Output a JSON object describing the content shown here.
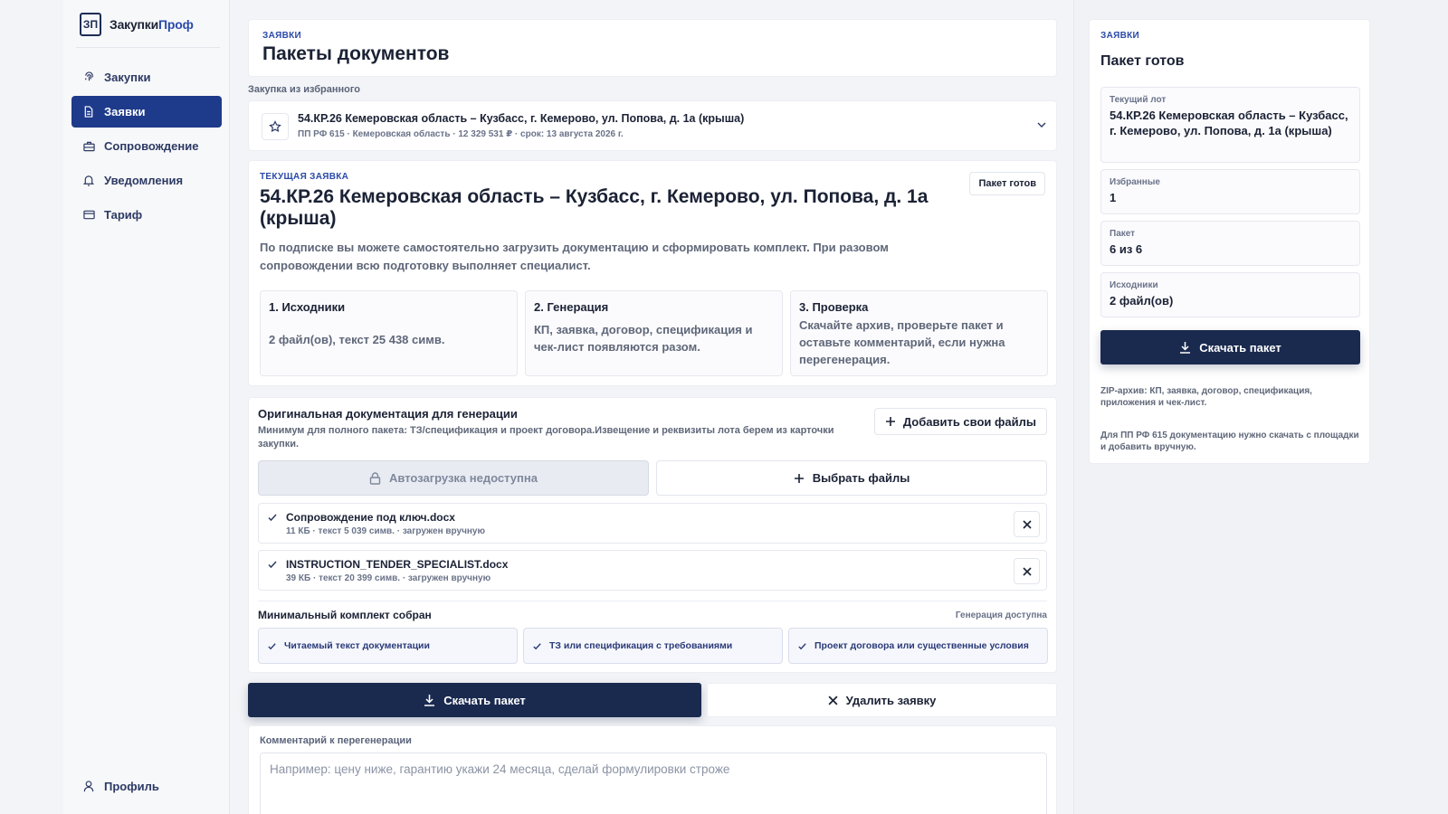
{
  "brand": {
    "name_part1": "Закупки",
    "name_part2": "Проф",
    "mark": "ЗП"
  },
  "sidebar": {
    "items": [
      {
        "label": "Закупки",
        "icon": "fingerprint-icon"
      },
      {
        "label": "Заявки",
        "icon": "document-icon",
        "active": true
      },
      {
        "label": "Сопровождение",
        "icon": "briefcase-icon"
      },
      {
        "label": "Уведомления",
        "icon": "bell-icon"
      },
      {
        "label": "Тариф",
        "icon": "card-icon"
      }
    ],
    "profile": "Профиль"
  },
  "header": {
    "eyebrow": "ЗАЯВКИ",
    "title": "Пакеты документов"
  },
  "lot_select": {
    "label": "Закупка из избранного",
    "title": "54.КР.26 Кемеровская область – Кузбасс, г. Кемерово, ул. Попова, д. 1а (крыша)",
    "subtitle": "ПП РФ 615 · Кемеровская область · 12 329 531 ₽ · срок: 13 августа 2026 г."
  },
  "current": {
    "eyebrow": "ТЕКУЩАЯ ЗАЯВКА",
    "badge": "Пакет готов",
    "title": "54.КР.26 Кемеровская область – Кузбасс, г. Кемерово, ул. Попова, д. 1а (крыша)",
    "description": "По подписке вы можете самостоятельно загрузить документацию и сформировать комплект. При разовом сопровождении всю подготовку выполняет специалист.",
    "steps": [
      {
        "title": "1. Исходники",
        "text": "2 файл(ов), текст 25 438 симв."
      },
      {
        "title": "2. Генерация",
        "text": "КП, заявка, договор, спецификация и чек-лист появляются разом."
      },
      {
        "title": "3. Проверка",
        "text": "Скачайте архив, проверьте пакет и оставьте комментарий, если нужна перегенерация."
      }
    ]
  },
  "originals": {
    "title": "Оригинальная документация для генерации",
    "description": "Минимум для полного пакета: ТЗ/спецификация и проект договора.Извещение и реквизиты лота берем из карточки закупки.",
    "add_button": "Добавить свои файлы",
    "auto_button": "Автозагрузка недоступна",
    "pick_button": "Выбрать файлы",
    "files": [
      {
        "name": "Сопровождение под ключ.docx",
        "meta": "11 КБ · текст 5 039 симв. · загружен вручную"
      },
      {
        "name": "INSTRUCTION_TENDER_SPECIALIST.docx",
        "meta": "39 КБ · текст 20 399 симв. · загружен вручную"
      }
    ],
    "min_title": "Минимальный комплект собран",
    "min_status": "Генерация доступна",
    "checks": [
      "Читаемый текст документации",
      "ТЗ или спецификация с требованиями",
      "Проект договора или существенные условия"
    ]
  },
  "actions": {
    "download": "Скачать пакет",
    "delete": "Удалить заявку"
  },
  "comment": {
    "label": "Комментарий к перегенерации",
    "placeholder": "Например: цену ниже, гарантию укажи 24 месяца, сделай формулировки строже"
  },
  "summary": {
    "eyebrow": "ЗАЯВКИ",
    "title": "Пакет готов",
    "fields": [
      {
        "label": "Текущий лот",
        "value": "54.КР.26 Кемеровская область – Кузбасс, г. Кемерово, ул. Попова, д. 1а (крыша)"
      },
      {
        "label": "Избранные",
        "value": "1"
      },
      {
        "label": "Пакет",
        "value": "6 из 6"
      },
      {
        "label": "Исходники",
        "value": "2 файл(ов)"
      }
    ],
    "download": "Скачать пакет",
    "note1": "ZIP-архив: КП, заявка, договор, спецификация, приложения и чек-лист.",
    "note2": "Для ПП РФ 615 документацию нужно скачать с площадки и добавить вручную."
  },
  "colors": {
    "accent": "#1e3a8a",
    "primary_button": "#1a2a4f",
    "brand_accent": "#2a4aa8"
  }
}
